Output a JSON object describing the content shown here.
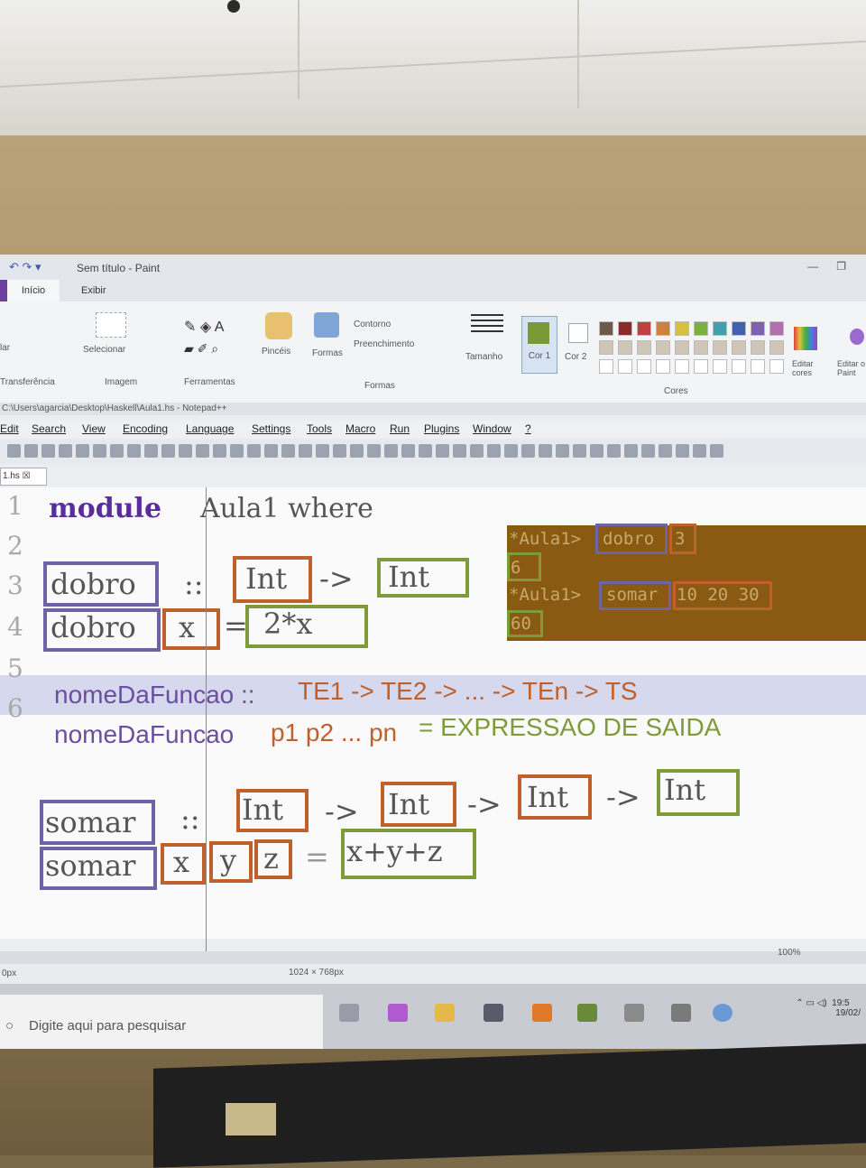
{
  "paint": {
    "title": "Sem título - Paint",
    "tabs": [
      "Início",
      "Exibir"
    ],
    "groups": {
      "clipboard_partial": "lar",
      "transfer": "Transferência",
      "select": "Selecionar",
      "image": "Imagem",
      "tools": "Ferramentas",
      "brushes": "Pincéis",
      "shapes": "Formas",
      "outline": "Contorno",
      "fill": "Preenchimento",
      "shapes_group": "Formas",
      "size": "Tamanho",
      "color1": "Cor 1",
      "color2": "Cor 2",
      "colors": "Cores",
      "edit_colors": "Editar cores",
      "edit_paint3d": "Editar o Paint"
    },
    "color1": "#7a9a3a",
    "palette": [
      "#6b5a4a",
      "#8a2a2a",
      "#c04040",
      "#d0803a",
      "#d8c040",
      "#7ab040",
      "#40a0b0",
      "#4060b0",
      "#8060b0",
      "#b070b0"
    ],
    "status": {
      "size": "1024 × 768px",
      "zoom": "100%",
      "px": "0px"
    }
  },
  "notepad": {
    "path": "C:\\Users\\agarcia\\Desktop\\Haskell\\Aula1.hs - Notepad++",
    "menu": [
      "Edit",
      "Search",
      "View",
      "Encoding",
      "Language",
      "Settings",
      "Tools",
      "Macro",
      "Run",
      "Plugins",
      "Window",
      "?"
    ],
    "tab": "1.hs",
    "line_numbers": [
      "1",
      "2",
      "3",
      "4",
      "5",
      "6"
    ],
    "code": {
      "l1_kw": "module",
      "l1_rest": "Aula1 where",
      "l3_name": "dobro",
      "l3_sig": "::",
      "l3_t1": "Int",
      "l3_arrow": "->",
      "l3_t2": "Int",
      "l4_name": "dobro",
      "l4_arg": "x",
      "l4_eq": "=",
      "l4_expr": "2*x",
      "l6_a": "nomeDaFuncao ::",
      "l6_b": "TE1 -> TE2 -> ... -> TEn -> TS",
      "l7_a": "nomeDaFuncao",
      "l7_b": "p1 p2 ... pn",
      "l7_c": "= EXPRESSAO DE SAIDA",
      "s1_name": "somar",
      "s1_sig": "::",
      "s1_t1": "Int",
      "s1_a1": "->",
      "s1_t2": "Int",
      "s1_a2": "->",
      "s1_t3": "Int",
      "s1_a3": "->",
      "s1_t4": "Int",
      "s2_name": "somar",
      "s2_x": "x",
      "s2_y": "y",
      "s2_z": "z",
      "s2_eq": "=",
      "s2_expr": "x+y+z"
    },
    "terminal": {
      "p1": "*Aula1>",
      "c1": "dobro",
      "a1": "3",
      "r1": "6",
      "p2": "*Aula1>",
      "c2": "somar",
      "a2": "10 20 30",
      "r2": "60"
    }
  },
  "taskbar": {
    "search_placeholder": "Digite aqui para pesquisar",
    "time": "19:5",
    "date": "19/02/"
  }
}
